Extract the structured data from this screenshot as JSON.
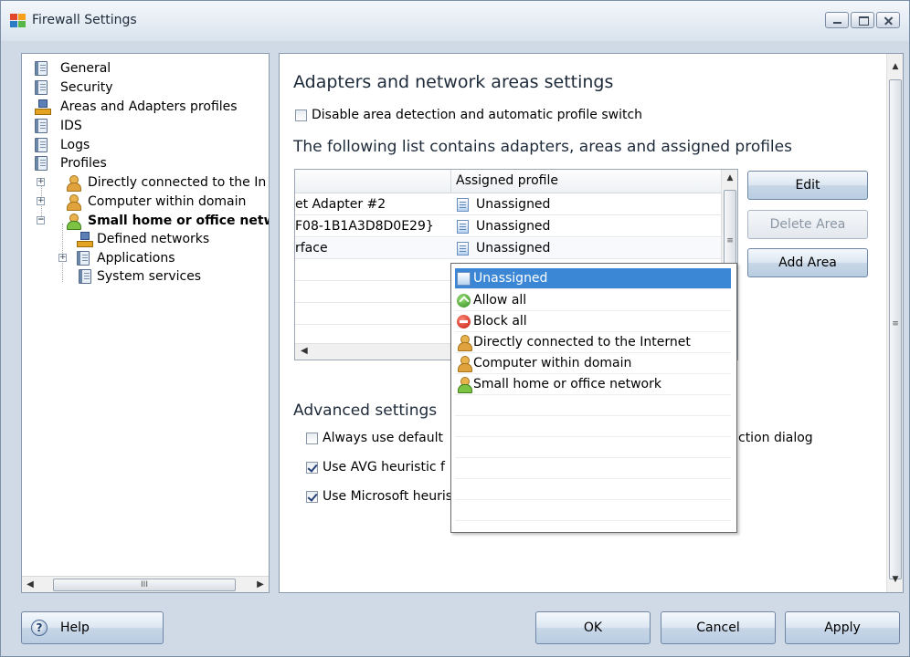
{
  "window": {
    "title": "Firewall Settings"
  },
  "tree": {
    "items": [
      {
        "label": "General",
        "icon": "document-icon"
      },
      {
        "label": "Security",
        "icon": "document-icon"
      },
      {
        "label": "Areas and Adapters profiles",
        "icon": "network-icon"
      },
      {
        "label": "IDS",
        "icon": "document-icon"
      },
      {
        "label": "Logs",
        "icon": "document-icon"
      },
      {
        "label": "Profiles",
        "icon": "document-icon"
      },
      {
        "label": "Directly connected to the In",
        "icon": "user-icon"
      },
      {
        "label": "Computer within domain",
        "icon": "user-icon"
      },
      {
        "label": "Small home or office netw",
        "icon": "user-green-icon"
      },
      {
        "label": "Defined networks",
        "icon": "network-icon"
      },
      {
        "label": "Applications",
        "icon": "document-icon"
      },
      {
        "label": "System services",
        "icon": "document-icon"
      }
    ],
    "scroll_thumb_grip": "III"
  },
  "content": {
    "heading": "Adapters and network areas settings",
    "disable_detection": {
      "label": "Disable area detection and automatic profile switch",
      "checked": false
    },
    "list_heading": "The following list contains adapters, areas and assigned profiles",
    "grid": {
      "columns": [
        "",
        "Assigned profile"
      ],
      "rows": [
        {
          "adapter": "et Adapter #2",
          "profile": "Unassigned"
        },
        {
          "adapter": "F08-1B1A3D8D0E29}",
          "profile": "Unassigned"
        },
        {
          "adapter": "rface",
          "profile": "Unassigned"
        }
      ]
    },
    "buttons": {
      "edit": "Edit",
      "delete_area": "Delete Area",
      "add_area": "Add Area"
    },
    "advanced_heading": "Advanced settings",
    "advanced": [
      {
        "label_left": "Always use default",
        "label_right": "ction dialog",
        "checked": false
      },
      {
        "label_left": "Use AVG heuristic f",
        "checked": true
      },
      {
        "label_left": "Use Microsoft heuris",
        "checked": true
      }
    ]
  },
  "dropdown": {
    "options": [
      {
        "label": "Unassigned",
        "icon": "unassigned-icon",
        "selected": true
      },
      {
        "label": "Allow all",
        "icon": "allow-icon",
        "selected": false
      },
      {
        "label": "Block all",
        "icon": "block-icon",
        "selected": false
      },
      {
        "label": "Directly connected to the Internet",
        "icon": "user-icon",
        "selected": false
      },
      {
        "label": "Computer within domain",
        "icon": "user-icon",
        "selected": false
      },
      {
        "label": "Small home or office network",
        "icon": "user-green-icon",
        "selected": false
      }
    ]
  },
  "footer": {
    "help": "Help",
    "ok": "OK",
    "cancel": "Cancel",
    "apply": "Apply"
  },
  "colors": {
    "selection": "#3b87d6",
    "window_bg": "#cfdae6"
  }
}
